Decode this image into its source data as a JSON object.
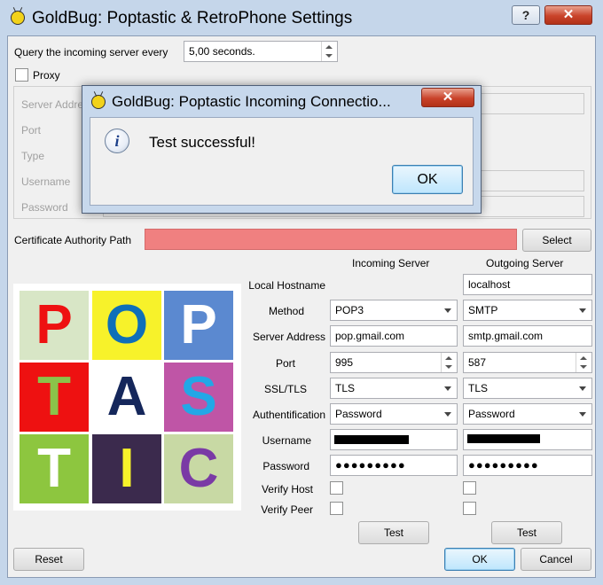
{
  "window": {
    "title": "GoldBug: Poptastic & RetroPhone Settings",
    "help_button": "?",
    "close_button": "✕"
  },
  "query": {
    "label": "Query the incoming server every",
    "value": "5,00 seconds."
  },
  "proxy": {
    "label": "Proxy",
    "checked": false,
    "fields": [
      "Server Address",
      "Port",
      "Type",
      "Username",
      "Password"
    ]
  },
  "ca": {
    "label": "Certificate Authority Path",
    "value": "",
    "select_button": "Select",
    "field_color": "#f08080"
  },
  "columns": {
    "incoming": "Incoming Server",
    "outgoing": "Outgoing Server"
  },
  "rows": {
    "local_hostname": {
      "label": "Local Hostname",
      "incoming": "",
      "outgoing": "localhost"
    },
    "method": {
      "label": "Method",
      "incoming": "POP3",
      "outgoing": "SMTP"
    },
    "server_address": {
      "label": "Server Address",
      "incoming": "pop.gmail.com",
      "outgoing": "smtp.gmail.com"
    },
    "port": {
      "label": "Port",
      "incoming": "995",
      "outgoing": "587"
    },
    "ssl_tls": {
      "label": "SSL/TLS",
      "incoming": "TLS",
      "outgoing": "TLS"
    },
    "authentication": {
      "label": "Authentification",
      "incoming": "Password",
      "outgoing": "Password"
    },
    "username": {
      "label": "Username"
    },
    "password": {
      "label": "Password",
      "incoming": "●●●●●●●●●",
      "outgoing": "●●●●●●●●●"
    },
    "verify_host": {
      "label": "Verify Host"
    },
    "verify_peer": {
      "label": "Verify Peer"
    }
  },
  "test_buttons": {
    "incoming": "Test",
    "outgoing": "Test"
  },
  "footer": {
    "reset": "Reset",
    "ok": "OK",
    "cancel": "Cancel"
  },
  "logo": {
    "tiles": [
      {
        "letter": "P",
        "bg": "#d8e6c6",
        "fg": "#ee1111"
      },
      {
        "letter": "O",
        "bg": "#f7f22a",
        "fg": "#0f6fb8"
      },
      {
        "letter": "P",
        "bg": "#5b89d0",
        "fg": "#ffffff"
      },
      {
        "letter": "T",
        "bg": "#ee1111",
        "fg": "#8bc34a"
      },
      {
        "letter": "A",
        "bg": "#ffffff",
        "fg": "#15275b"
      },
      {
        "letter": "S",
        "bg": "#bf55a6",
        "fg": "#22a7e6"
      },
      {
        "letter": "T",
        "bg": "#8dc63f",
        "fg": "#ffffff"
      },
      {
        "letter": "I",
        "bg": "#3b2a4d",
        "fg": "#f7f22a"
      },
      {
        "letter": "C",
        "bg": "#c8d9a4",
        "fg": "#7a3aa5"
      }
    ]
  },
  "dialog": {
    "title": "GoldBug: Poptastic Incoming Connectio...",
    "close_button": "✕",
    "info_icon": "info-icon",
    "message": "Test successful!",
    "ok_button": "OK"
  }
}
